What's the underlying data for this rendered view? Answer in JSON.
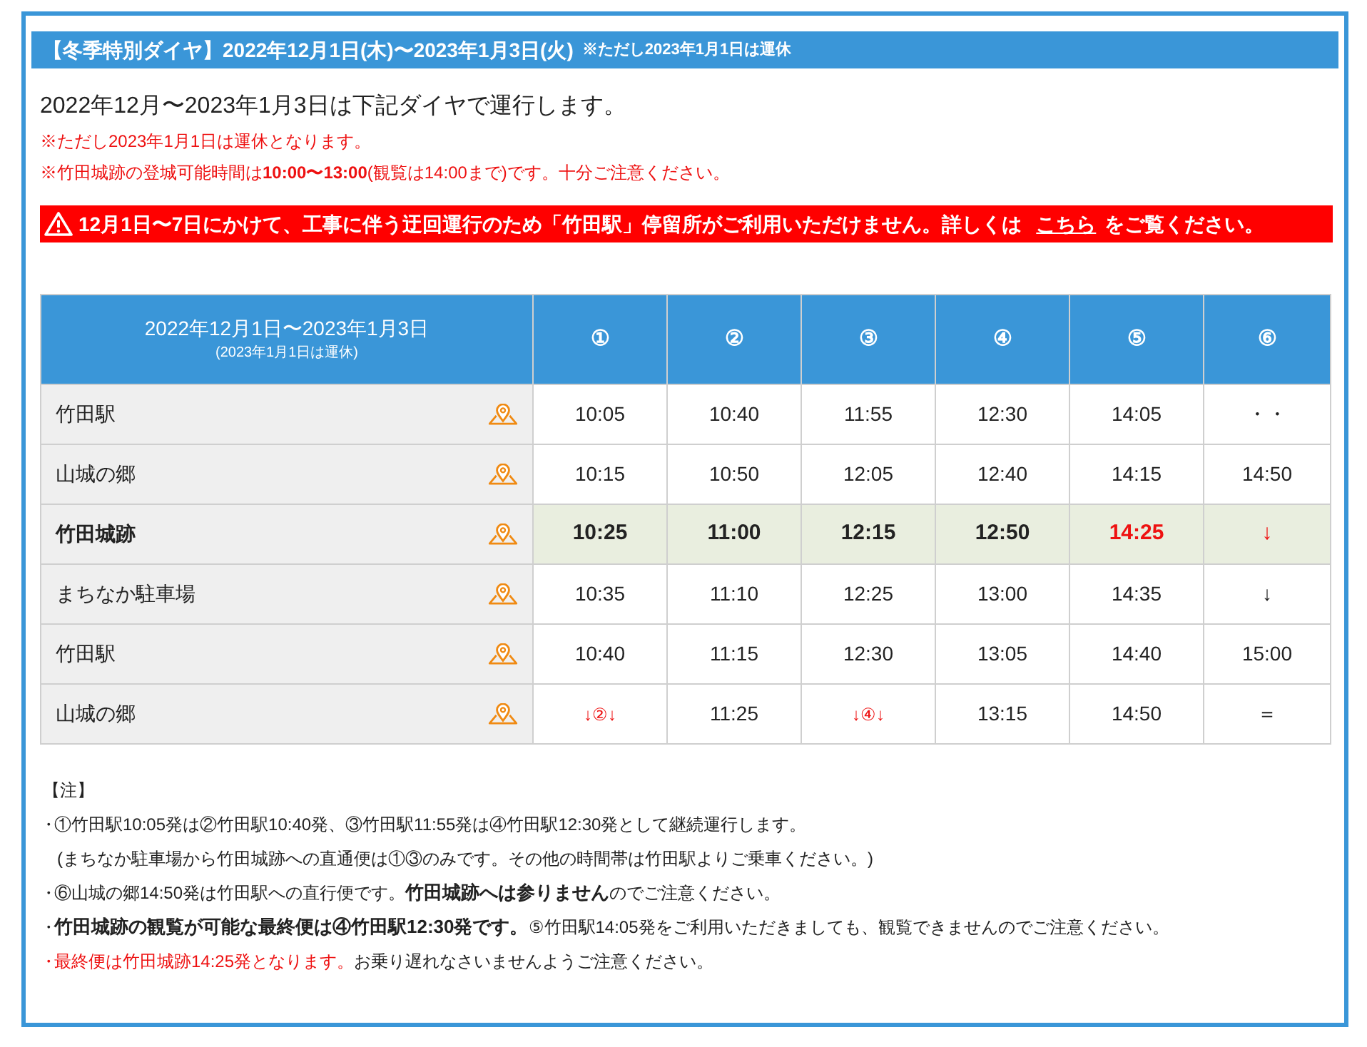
{
  "title_bar": {
    "title": "【冬季特別ダイヤ】2022年12月1日(木)〜2023年1月3日(火)",
    "note": "※ただし2023年1月1日は運休"
  },
  "intro": "2022年12月〜2023年1月3日は下記ダイヤで運行します。",
  "alerts": [
    "※ただし2023年1月1日は運休となります。",
    "※竹田城跡の登城可能時間は**10:00〜13:00**(観覧は14:00まで)です。十分ご注意ください。"
  ],
  "warning": {
    "before": "12月1日〜7日にかけて、工事に伴う迂回運行のため「竹田駅」停留所がご利用いただけません。詳しくは",
    "link": "こちら",
    "after": "をご覧ください。"
  },
  "table": {
    "header": {
      "title": "2022年12月1日〜2023年1月3日",
      "subtitle": "(2023年1月1日は運休)"
    },
    "columns": [
      "①",
      "②",
      "③",
      "④",
      "⑤",
      "⑥"
    ],
    "rows": [
      {
        "stop": "竹田駅",
        "highlighted": false,
        "cells": [
          {
            "text": "10:05"
          },
          {
            "text": "10:40"
          },
          {
            "text": "11:55"
          },
          {
            "text": "12:30"
          },
          {
            "text": "14:05"
          },
          {
            "text": "・・"
          }
        ]
      },
      {
        "stop": "山城の郷",
        "highlighted": false,
        "cells": [
          {
            "text": "10:15"
          },
          {
            "text": "10:50"
          },
          {
            "text": "12:05"
          },
          {
            "text": "12:40"
          },
          {
            "text": "14:15"
          },
          {
            "text": "14:50"
          }
        ]
      },
      {
        "stop": "竹田城跡",
        "highlighted": true,
        "cells": [
          {
            "text": "10:25"
          },
          {
            "text": "11:00"
          },
          {
            "text": "12:15"
          },
          {
            "text": "12:50"
          },
          {
            "text": "14:25",
            "kind": "alert"
          },
          {
            "text": "↓",
            "kind": "alert"
          }
        ]
      },
      {
        "stop": "まちなか駐車場",
        "highlighted": false,
        "cells": [
          {
            "text": "10:35"
          },
          {
            "text": "11:10"
          },
          {
            "text": "12:25"
          },
          {
            "text": "13:00"
          },
          {
            "text": "14:35"
          },
          {
            "text": "↓"
          }
        ]
      },
      {
        "stop": "竹田駅",
        "highlighted": false,
        "cells": [
          {
            "text": "10:40"
          },
          {
            "text": "11:15"
          },
          {
            "text": "12:30"
          },
          {
            "text": "13:05"
          },
          {
            "text": "14:40"
          },
          {
            "text": "15:00"
          }
        ]
      },
      {
        "stop": "山城の郷",
        "highlighted": false,
        "cells": [
          {
            "text": "↓②↓",
            "kind": "alert-small"
          },
          {
            "text": "11:25"
          },
          {
            "text": "↓④↓",
            "kind": "alert-small"
          },
          {
            "text": "13:15"
          },
          {
            "text": "14:50"
          },
          {
            "text": "＝"
          }
        ]
      }
    ]
  },
  "notes": {
    "heading": "【注】",
    "items": [
      {
        "bullet": "・",
        "bullet_red": false,
        "parts": [
          {
            "text": "①竹田駅10:05発は②竹田駅10:40発、③竹田駅11:55発は④竹田駅12:30発として継続運行します。",
            "kind": "plain"
          }
        ],
        "continuation": "(まちなか駐車場から竹田城跡への直通便は①③のみです。その他の時間帯は竹田駅よりご乗車ください。)"
      },
      {
        "bullet": "・",
        "bullet_red": false,
        "parts": [
          {
            "text": "⑥山城の郷14:50発は竹田駅への直行便です。",
            "kind": "plain"
          },
          {
            "text": "竹田城跡へは参りません",
            "kind": "bold"
          },
          {
            "text": "のでご注意ください。",
            "kind": "plain"
          }
        ]
      },
      {
        "bullet": "・",
        "bullet_red": false,
        "parts": [
          {
            "text": "竹田城跡の観覧が可能な最終便は④竹田駅12:30発です。",
            "kind": "bold"
          },
          {
            "text": "⑤竹田駅14:05発をご利用いただきましても、観覧できませんのでご注意ください。",
            "kind": "plain"
          }
        ]
      },
      {
        "bullet": "・",
        "bullet_red": true,
        "parts": [
          {
            "text": "最終便は竹田城跡14:25発となります。",
            "kind": "alert"
          },
          {
            "text": "お乗り遅れなさいませんようご注意ください。",
            "kind": "plain"
          }
        ]
      }
    ]
  }
}
